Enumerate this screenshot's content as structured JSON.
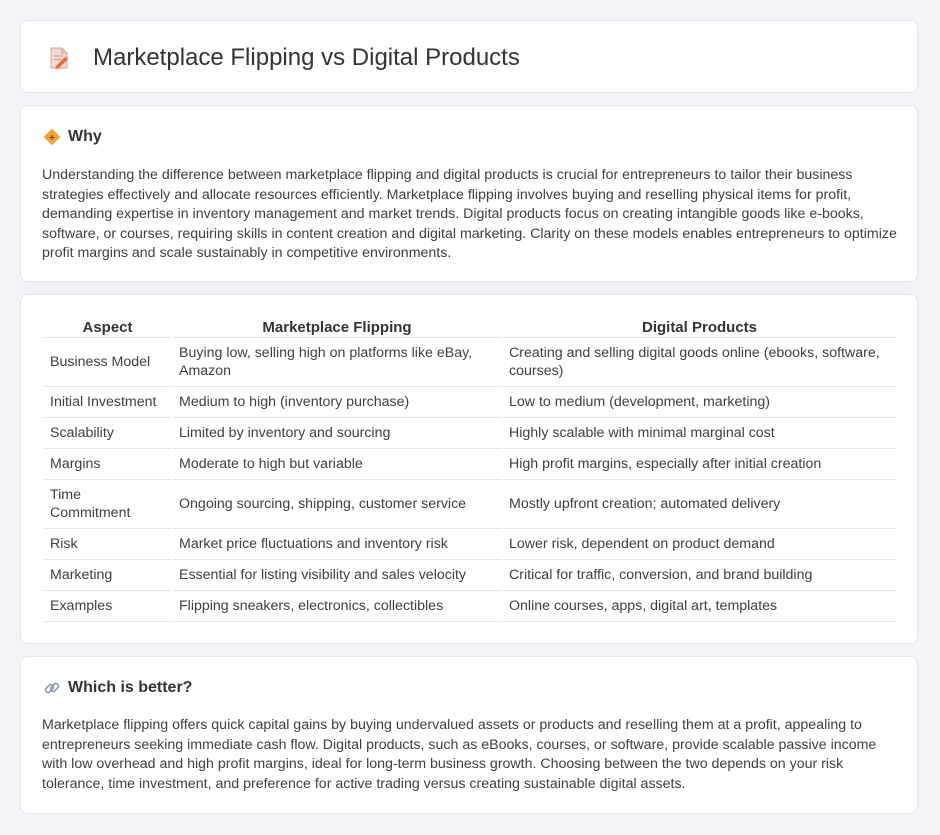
{
  "header": {
    "title": "Marketplace Flipping vs Digital Products",
    "icon": "document-pencil-icon"
  },
  "why": {
    "heading": "Why",
    "icon": "diamond-sign-icon",
    "text": "Understanding the difference between marketplace flipping and digital products is crucial for entrepreneurs to tailor their business strategies effectively and allocate resources efficiently. Marketplace flipping involves buying and reselling physical items for profit, demanding expertise in inventory management and market trends. Digital products focus on creating intangible goods like e-books, software, or courses, requiring skills in content creation and digital marketing. Clarity on these models enables entrepreneurs to optimize profit margins and scale sustainably in competitive environments."
  },
  "comparison": {
    "columns": [
      "Aspect",
      "Marketplace Flipping",
      "Digital Products"
    ],
    "rows": [
      [
        "Business Model",
        "Buying low, selling high on platforms like eBay, Amazon",
        "Creating and selling digital goods online (ebooks, software, courses)"
      ],
      [
        "Initial Investment",
        "Medium to high (inventory purchase)",
        "Low to medium (development, marketing)"
      ],
      [
        "Scalability",
        "Limited by inventory and sourcing",
        "Highly scalable with minimal marginal cost"
      ],
      [
        "Margins",
        "Moderate to high but variable",
        "High profit margins, especially after initial creation"
      ],
      [
        "Time Commitment",
        "Ongoing sourcing, shipping, customer service",
        "Mostly upfront creation; automated delivery"
      ],
      [
        "Risk",
        "Market price fluctuations and inventory risk",
        "Lower risk, dependent on product demand"
      ],
      [
        "Marketing",
        "Essential for listing visibility and sales velocity",
        "Critical for traffic, conversion, and brand building"
      ],
      [
        "Examples",
        "Flipping sneakers, electronics, collectibles",
        "Online courses, apps, digital art, templates"
      ]
    ]
  },
  "better": {
    "heading": "Which is better?",
    "icon": "link-icon",
    "text": "Marketplace flipping offers quick capital gains by buying undervalued assets or products and reselling them at a profit, appealing to entrepreneurs seeking immediate cash flow. Digital products, such as eBooks, courses, or software, provide scalable passive income with low overhead and high profit margins, ideal for long-term business growth. Choosing between the two depends on your risk tolerance, time investment, and preference for active trading versus creating sustainable digital assets."
  }
}
